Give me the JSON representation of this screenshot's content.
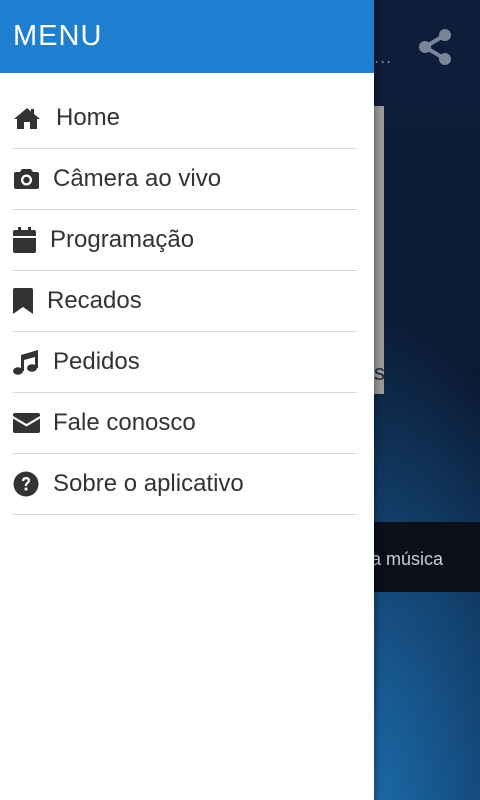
{
  "drawer": {
    "title": "MENU",
    "items": [
      {
        "label": "Home",
        "icon": "home-icon"
      },
      {
        "label": "Câmera ao vivo",
        "icon": "camera-icon"
      },
      {
        "label": "Programação",
        "icon": "calendar-icon"
      },
      {
        "label": "Recados",
        "icon": "bookmark-icon"
      },
      {
        "label": "Pedidos",
        "icon": "music-icon"
      },
      {
        "label": "Fale conosco",
        "icon": "envelope-icon"
      },
      {
        "label": "Sobre o aplicativo",
        "icon": "question-circle-icon"
      }
    ]
  },
  "background": {
    "dots": "...",
    "card_text": "s",
    "bar_text": "a música"
  },
  "colors": {
    "header": "#1e7fd0",
    "text": "#333333",
    "divider": "#d9d9d9",
    "drawer_bg": "#ffffff",
    "app_bg": "#0b1a33"
  }
}
